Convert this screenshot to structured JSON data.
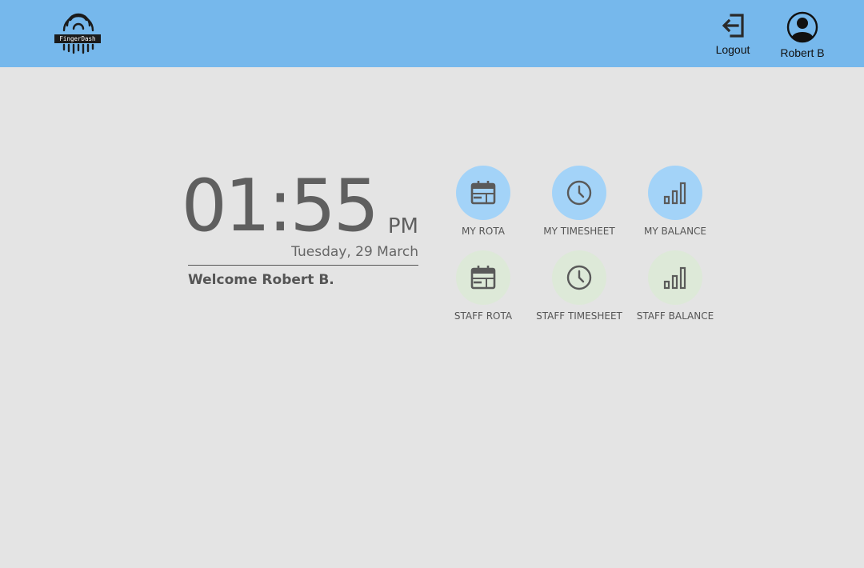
{
  "header": {
    "logo_text": "FingerDash",
    "logout_label": "Logout",
    "user_label": "Robert B"
  },
  "clock": {
    "time": "01:55",
    "ampm": "PM",
    "date": "Tuesday, 29 March",
    "welcome": "Welcome Robert B."
  },
  "tiles": [
    {
      "label": "MY ROTA",
      "icon": "calendar-icon"
    },
    {
      "label": "MY TIMESHEET",
      "icon": "clock-icon"
    },
    {
      "label": "MY BALANCE",
      "icon": "bar-chart-icon"
    },
    {
      "label": "STAFF ROTA",
      "icon": "calendar-icon"
    },
    {
      "label": "STAFF TIMESHEET",
      "icon": "clock-icon"
    },
    {
      "label": "STAFF BALANCE",
      "icon": "bar-chart-icon"
    }
  ],
  "colors": {
    "header": "#76b8ec",
    "background": "#e4e4e4",
    "my_tile": "#a3d3f8",
    "staff_tile": "#dde9d8"
  }
}
